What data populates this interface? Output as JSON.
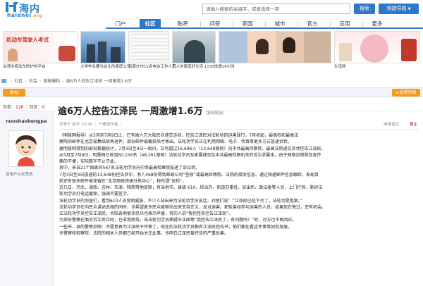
{
  "header": {
    "logo_cn": "海内",
    "logo_en": "haienei",
    "logo_en_suffix": ".org",
    "search_placeholder": "请输入搜索的关键字，或者选择一项",
    "search_label": "搜索",
    "quick_nav_label": "快捷导航"
  },
  "nav": {
    "items": [
      {
        "label": "门户"
      },
      {
        "label": "社区"
      },
      {
        "label": "贴吧"
      },
      {
        "label": "问答"
      },
      {
        "label": "家园"
      },
      {
        "label": "城市"
      },
      {
        "label": "官方"
      },
      {
        "label": "应用"
      },
      {
        "label": "更多"
      }
    ],
    "active_index": 1
  },
  "banner": {
    "cards": [
      {
        "caption": "台湾市机动车防护的平台"
      },
      {
        "caption": "大学毕业要当台北的家庭公司"
      },
      {
        "caption": "石家庄市12名电台工作人员"
      },
      {
        "caption": "万人的家庭好生活 1130快速24小时"
      },
      {
        "caption": "生活网"
      }
    ]
  },
  "breadcrumb": {
    "items": [
      "社区",
      "社会",
      "草根爆料",
      "逾6万人控告江泽民 一周激增1.6万"
    ]
  },
  "actions": {
    "post_label": "发帖",
    "reply_label": "返回列表"
  },
  "stats": {
    "views_label": "查看：",
    "views": "126",
    "replies_label": "回复：",
    "replies": "0"
  },
  "author": {
    "name": "nuoshaobengpa",
    "note": "该用户从未签到"
  },
  "post": {
    "title": "逾6万人控告江泽民 一周激增1.6万",
    "tag": "[复制链接]",
    "meta": "发表于 前天 20:26 ｜ 只看该作者 ｜",
    "floor_label": "电梯直达",
    "floor": "楼主",
    "paragraphs": [
      "（明慧网报导）从5月到7月9日止，已有逾六万大陆民众递交诉状，控告江泽民对法轮功的迫害罪行。7月初起，最高检和最高法",
      "察院的邮件在北京被集结后再退件，部份邮件被截获后才寄出。法轮功学员正在利用网络、电子、传真等更多方式投递诉状。",
      "据明慧网得到的部份数据统计，7月3日至9日一周内，又有超过16,696人（13,648案例）向中共最高检察院、最高法院递交诉状控告江泽民。",
      "从5月至7月9日，明慧网已收到60,156名（48,261案例）法轮功学员及家属递交给中共最高检察机关的诉讼状副本。由于网络封锁和信息传",
      "输的不便，实际数字不止于此。",
      "其中，来自21个国家的567名法轮功学员向中共最高检察院投递了诉讼状。",
      "7月3日至9日投递的13,648份控告状中，有7,468份得到邮政公司“签收”或最高检察院、法院的接收信息。通过快递邮件信息跟踪，发现目",
      "前还有很多邮件被滞留在“北京邮政快递分拣中心”，称所谓“安检”。",
      "近几日，河北、湖南、吉林、天津、陕西等地反映，有当地市、县级 610、综治办、街道办事处、派出所、政法委等人员，上门打探，胁迫法",
      "轮功学员打电话撤案，强调不要签字。",
      "法轮功学员的邻居们，看到610人员变相威胁，不少人站出来为法轮功学员说话，对他们说：“江泽民已经下台了，法轮功是冤案。”",
      "法轮功学员在向民众讲述真相的同时，也希望更多民众能够站出来支持正义、反对迫害。那些曾经参与迫害的人员，如果现在悔过，还有机会。",
      "江法轮功学员控告江泽民，大陆各地很多民众也表示声援，有的人说“我也签名控告江泽民”。",
      "大部份警察在面对诉江民众时，已非常收敛。当法轮功学员质疑王正国等“我控告江泽民了，有问题吗？”时，对方也不再回应。",
      "一些市、县的警察反映：不愿意再为江泽民干坏事了，现在的法轮功学员都有江泽民控告书，他们都在看这件事情如何发展。",
      "多警察和检察院、法院的相关人员都已经开始关注此事。也明白江泽民被控告的严重后果。"
    ]
  }
}
